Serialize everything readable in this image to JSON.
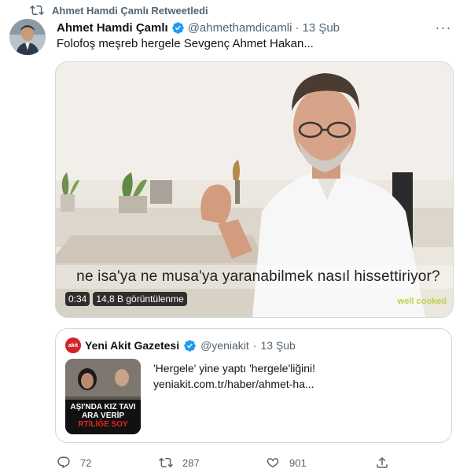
{
  "retweet": {
    "label": "Ahmet Hamdi Çamlı Retweetledi"
  },
  "tweet": {
    "author_name": "Ahmet Hamdi Çamlı",
    "handle": "@ahmethamdicamli",
    "separator": "·",
    "date": "13 Şub",
    "more": "···",
    "text": "Folofoş meşreb hergele Sevgenç Ahmet Hakan...",
    "video": {
      "subtitle": "ne isa'ya ne musa'ya yaranabilmek nasıl hissettiriyor?",
      "watermark": "well cooked",
      "duration": "0:34",
      "views": "14,8 B görüntülenme"
    }
  },
  "quote": {
    "logo_text": "akit",
    "name": "Yeni Akit Gazetesi",
    "handle": "@yeniakit",
    "separator": "·",
    "date": "13 Şub",
    "text": "'Hergele' yine yaptı 'hergele'liğini!",
    "link": "yeniakit.com.tr/haber/ahmet-ha...",
    "thumb_lines": [
      "AŞI'NDA KIZ TAVI",
      "ARA VERİP",
      "RTİLİĞE SOY"
    ]
  },
  "actions": {
    "reply_count": "72",
    "retweet_count": "287",
    "like_count": "901"
  },
  "colors": {
    "accent": "#1d9bf0",
    "muted": "#536471",
    "border": "#cfd9de",
    "akit_red": "#d2232a"
  }
}
